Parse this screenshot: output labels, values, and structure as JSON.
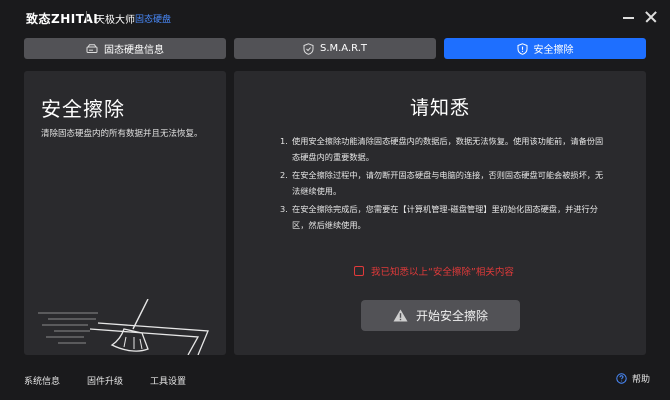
{
  "titlebar": {
    "logo": "致态ZHITAI",
    "app_name": "天极大师",
    "badge": "固态硬盘"
  },
  "tabs": [
    {
      "label": "固态硬盘信息",
      "icon": "drive-icon",
      "active": false
    },
    {
      "label": "S.M.A.R.T",
      "icon": "shield-check-icon",
      "active": false
    },
    {
      "label": "安全擦除",
      "icon": "shield-alert-icon",
      "active": true
    }
  ],
  "left_panel": {
    "title": "安全擦除",
    "description": "清除固态硬盘内的所有数据并且无法恢复。",
    "illustration": "broom-sweeping-drive-illustration"
  },
  "notice": {
    "title": "请知悉",
    "items": [
      {
        "num": "1.",
        "text": "使用安全擦除功能清除固态硬盘内的数据后，数据无法恢复。使用该功能前，请备份固态硬盘内的重要数据。"
      },
      {
        "num": "2.",
        "text": "在安全擦除过程中，请勿断开固态硬盘与电脑的连接，否则固态硬盘可能会被损坏，无法继续使用。"
      },
      {
        "num": "3.",
        "text": "在安全擦除完成后，您需要在【计算机管理-磁盘管理】里初始化固态硬盘，并进行分区，然后继续使用。"
      }
    ],
    "confirm_label": "我已知悉以上“安全擦除”相关内容",
    "confirm_checked": false,
    "start_button": "开始安全擦除",
    "start_icon": "warning-triangle-icon"
  },
  "footer": {
    "links": [
      "系统信息",
      "固件升级",
      "工具设置"
    ],
    "help": "帮助",
    "help_icon": "help-circle-icon"
  },
  "colors": {
    "accent": "#1e6fff",
    "background": "#1a1a1c",
    "panel": "#2a2a2d",
    "button": "#525256",
    "warning": "#e03a3a"
  }
}
